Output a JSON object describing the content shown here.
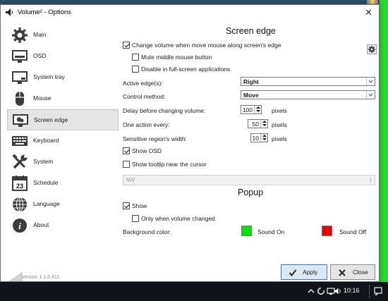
{
  "window": {
    "title": "Volume² - Options",
    "close": "✕"
  },
  "sidebar": {
    "items": [
      {
        "label": "Main"
      },
      {
        "label": "OSD"
      },
      {
        "label": "System tray"
      },
      {
        "label": "Mouse"
      },
      {
        "label": "Screen edge"
      },
      {
        "label": "Keyboard"
      },
      {
        "label": "System"
      },
      {
        "label": "Schedule"
      },
      {
        "label": "Language"
      },
      {
        "label": "About"
      }
    ],
    "selected": "Screen edge",
    "schedule_day": "23",
    "version": "version 1.1.6.411"
  },
  "screen_edge": {
    "title": "Screen edge",
    "change_volume_label": "Change volume when move mouse along screen's edge",
    "change_volume_checked": true,
    "mute_middle_label": "Mute middle mouse button",
    "mute_middle_checked": false,
    "disable_fullscreen_label": "Disable in full-screen applications",
    "disable_fullscreen_checked": false,
    "active_edges_label": "Active edge(s):",
    "active_edges_value": "Right",
    "control_method_label": "Control method:",
    "control_method_value": "Move",
    "delay_label": "Delay before changing volume:",
    "delay_value": "100",
    "one_action_label": "One action every:",
    "one_action_value": "50",
    "sensitive_label": "Sensitive region's width:",
    "sensitive_value": "10",
    "pixels_unit": "pixels",
    "show_osd_label": "Show OSD",
    "show_osd_checked": true,
    "show_tooltip_label": "Show tooltip near the cursor",
    "show_tooltip_checked": false,
    "tooltip_format_value": "%V",
    "info_glyph": "i"
  },
  "popup": {
    "title": "Popup",
    "show_label": "Show",
    "show_checked": true,
    "only_changed_label": "Only when volume changed",
    "only_changed_checked": false,
    "bg_color_label": "Background color:",
    "sound_on_label": "Sound On",
    "sound_on_color": "#00e600",
    "sound_off_label": "Sound Off",
    "sound_off_color": "#ee0000"
  },
  "buttons": {
    "apply": "Apply",
    "close": "Close"
  },
  "taskbar": {
    "time": "10:16"
  }
}
